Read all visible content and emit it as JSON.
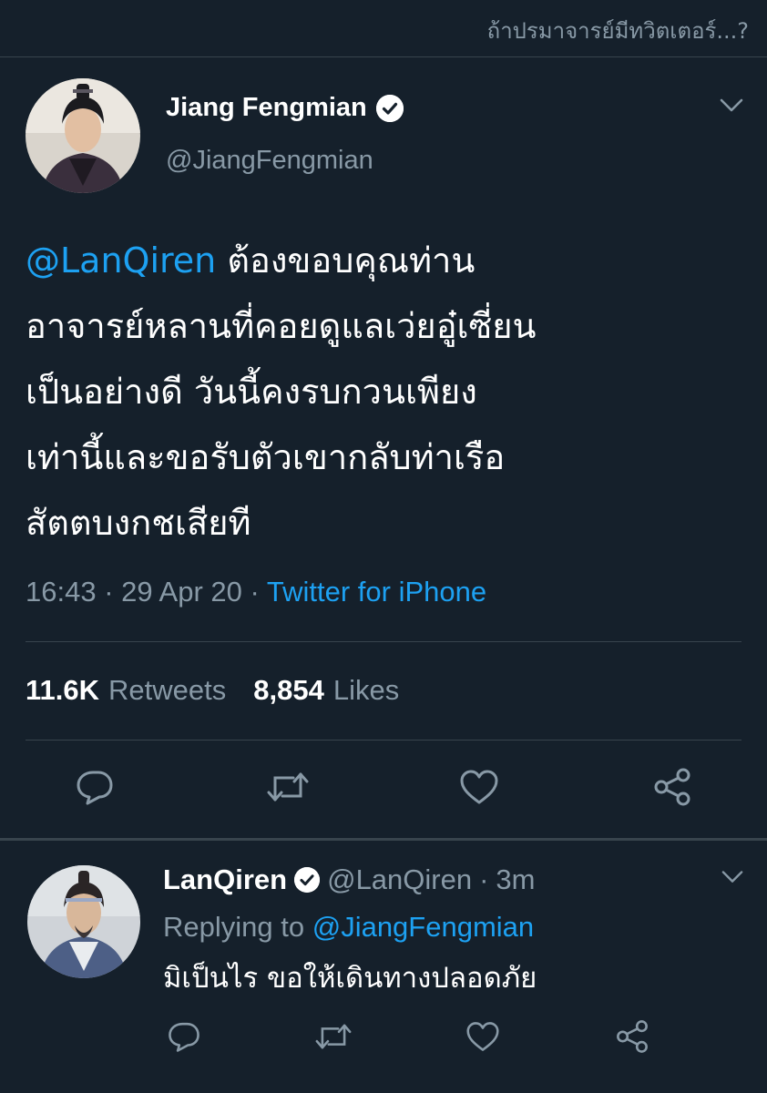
{
  "watermark": "ถ้าปรมาจารย์มีทวิตเตอร์...?",
  "tweet": {
    "author_name": "Jiang Fengmian",
    "author_handle": "@JiangFengmian",
    "mention": "@LanQiren",
    "body_lines": [
      "ต้องขอบคุณท่าน",
      "อาจารย์หลานที่คอยดูแลเว่ยอู๋เซี่ยน",
      "เป็นอย่างดี วันนี้คงรบกวนเพียง",
      "เท่านี้และขอรับตัวเขากลับท่าเรือ",
      "สัตตบงกชเสียที"
    ],
    "time": "16:43",
    "date": "29 Apr 20",
    "source": "Twitter for iPhone",
    "retweets_count": "11.6K",
    "retweets_label": "Retweets",
    "likes_count": "8,854",
    "likes_label": "Likes"
  },
  "reply": {
    "author_name": "LanQiren",
    "author_handle": "@LanQiren",
    "time_ago": "3m",
    "replying_prefix": "Replying to",
    "replying_to": "@JiangFengmian",
    "body": "มิเป็นไร ขอให้เดินทางปลอดภัย"
  },
  "icons": [
    "verified-badge-icon",
    "chevron-down-icon",
    "reply-icon",
    "retweet-icon",
    "like-icon",
    "share-icon"
  ],
  "colors": {
    "background": "#15202b",
    "text": "#ffffff",
    "secondary_text": "#8899a6",
    "accent": "#1da1f2",
    "divider": "#38444d"
  }
}
